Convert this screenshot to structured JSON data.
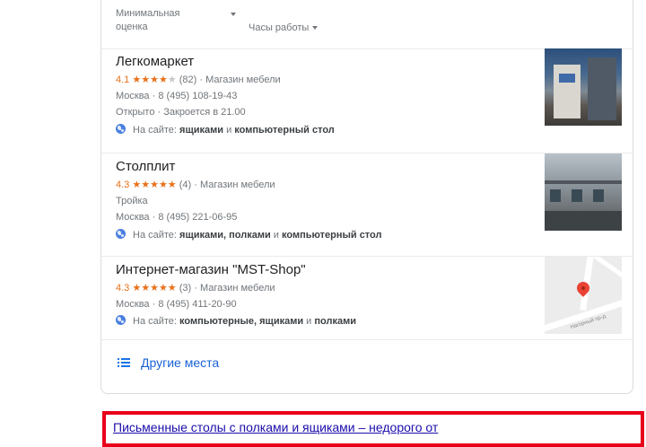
{
  "filters": {
    "min_rating": "Минимальная оценка",
    "hours": "Часы работы"
  },
  "places": [
    {
      "name": "Легкомаркет",
      "rating": "4.1",
      "stars": "★★★★",
      "stars_empty": "★",
      "reviews": "(82)",
      "category": "Магазин мебели",
      "address_phone": "Москва · 8 (495) 108-19-43",
      "status": "Открыто · Закроется в 21.00",
      "site_prefix": "На сайте:",
      "site_bold_1": "ящиками",
      "site_mid_1": "и",
      "site_bold_2": "компьютерный стол"
    },
    {
      "name": "Столплит",
      "rating": "4.3",
      "stars": "★★★★★",
      "reviews": "(4)",
      "category": "Магазин мебели",
      "area": "Тройка",
      "address_phone": "Москва · 8 (495) 221-06-95",
      "site_prefix": "На сайте:",
      "site_bold_1": "ящиками, полками",
      "site_mid_1": "и",
      "site_bold_2": "компьютерный стол"
    },
    {
      "name": "Интернет-магазин \"MST-Shop\"",
      "rating": "4.3",
      "stars": "★★★★★",
      "reviews": "(3)",
      "category": "Магазин мебели",
      "address_phone": "Москва · 8 (495) 411-20-90",
      "site_prefix": "На сайте:",
      "site_bold_1": "компьютерные, ящиками",
      "site_mid_1": "и",
      "site_bold_2": "полками",
      "map_road_label": "Нагорный пр-д"
    }
  ],
  "more_places": "Другие места",
  "result_link": "Письменные столы с полками и ящиками – недорого от",
  "colors": {
    "accent_rating": "#e7711b",
    "link": "#1a0dab",
    "highlight_border": "#e8001a"
  }
}
